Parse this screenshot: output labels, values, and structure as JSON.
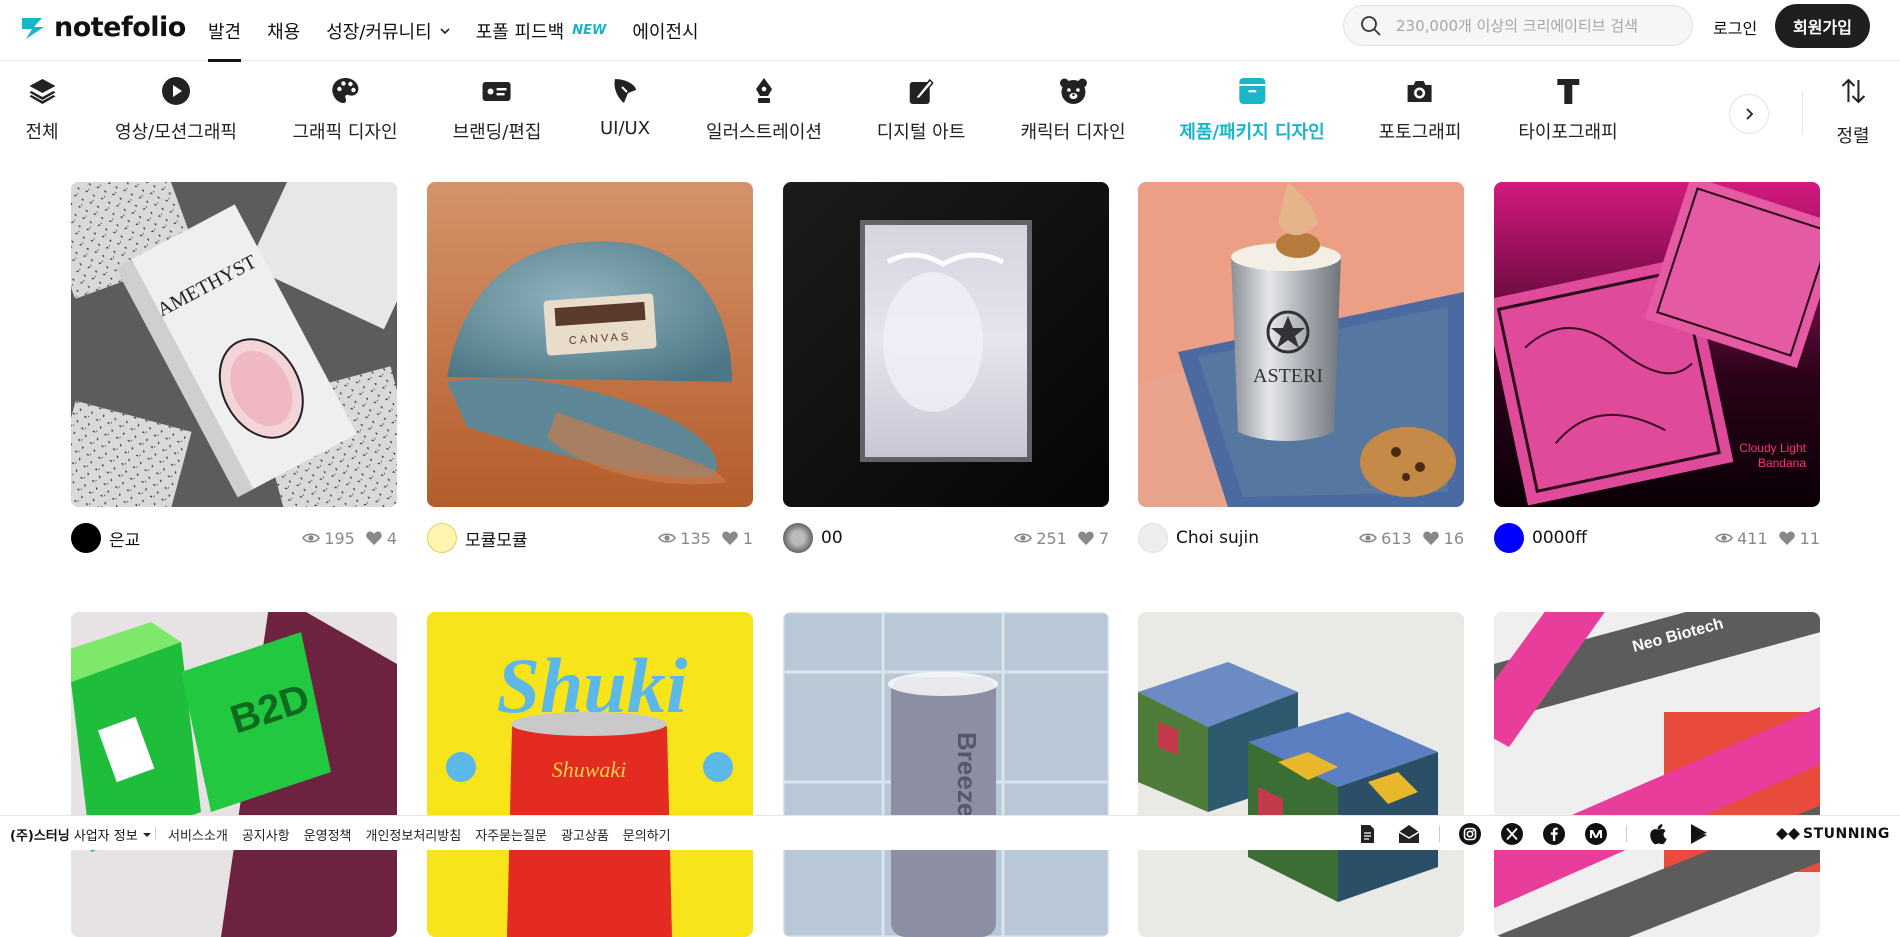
{
  "brand": {
    "name": "notefolio",
    "accent": "#19b6c8"
  },
  "nav": {
    "items": [
      {
        "label": "발견",
        "active": true
      },
      {
        "label": "채용"
      },
      {
        "label": "성장/커뮤니티"
      },
      {
        "label": "포폴 피드백",
        "badge": "NEW"
      },
      {
        "label": "에이전시"
      }
    ],
    "search_placeholder": "230,000개 이상의 크리에이티브 검색",
    "login": "로그인",
    "signup": "회원가입"
  },
  "categories": [
    {
      "label": "전체",
      "icon": "layers-icon"
    },
    {
      "label": "영상/모션그래픽",
      "icon": "play-icon"
    },
    {
      "label": "그래픽 디자인",
      "icon": "palette-icon"
    },
    {
      "label": "브랜딩/편집",
      "icon": "id-card-icon"
    },
    {
      "label": "UI/UX",
      "icon": "cursor-icon"
    },
    {
      "label": "일러스트레이션",
      "icon": "pen-nib-icon"
    },
    {
      "label": "디지털 아트",
      "icon": "tablet-pen-icon"
    },
    {
      "label": "캐릭터 디자인",
      "icon": "bear-icon"
    },
    {
      "label": "제품/패키지 디자인",
      "icon": "package-icon",
      "active": true
    },
    {
      "label": "포토그래피",
      "icon": "camera-icon"
    },
    {
      "label": "타이포그래피",
      "icon": "type-icon"
    }
  ],
  "sort_label": "정렬",
  "row1": [
    {
      "author": "은교",
      "views": "195",
      "likes": "4",
      "avatar_color": "#000000",
      "image": "amethyst-box"
    },
    {
      "author": "모큘모큘",
      "views": "135",
      "likes": "1",
      "avatar_color": "#fff5b0",
      "image": "denim-cap"
    },
    {
      "author": "00",
      "views": "251",
      "likes": "7",
      "avatar_color": "#8a8a8a",
      "image": "frosted-poster"
    },
    {
      "author": "Choi sujin",
      "views": "613",
      "likes": "16",
      "avatar_color": "#eeeeee",
      "image": "asteri-cup"
    },
    {
      "author": "0000ff",
      "views": "411",
      "likes": "11",
      "avatar_color": "#0000ff",
      "image": "pink-bandana"
    }
  ],
  "row2_images": [
    "b2d-box",
    "shuki-can",
    "breeze-soap",
    "pattern-boxes",
    "neo-biotech-tape"
  ],
  "image_text": {
    "amethyst": "AMETHYST",
    "caps": "CANVAS",
    "asteri": "ASTERI",
    "bandana": [
      "Cloudy Light",
      "Bandana"
    ],
    "b2d": "B2D",
    "shuki": "Shuki",
    "shuwaki": "Shuwaki",
    "breeze": "Breeze",
    "neo": "Neo Biotech"
  },
  "footer": {
    "company": "(주)스터닝",
    "company_info": "사업자 정보",
    "links": [
      "서비스소개",
      "공지사항",
      "운영정책",
      "개인정보처리방침",
      "자주묻는질문",
      "광고상품",
      "문의하기"
    ],
    "brand": "STUNNING"
  }
}
